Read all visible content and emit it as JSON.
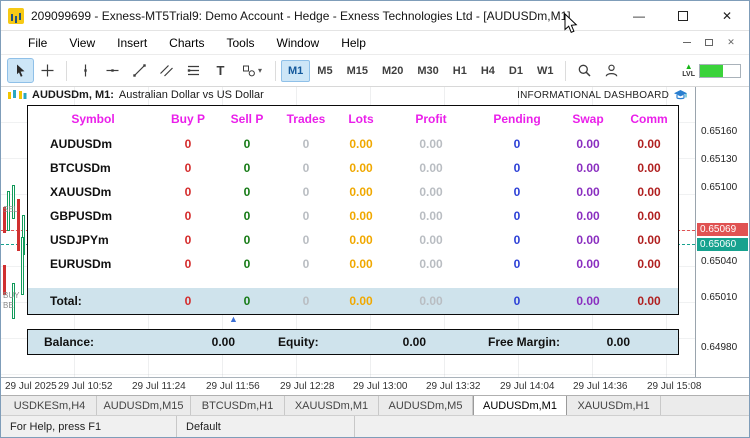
{
  "window": {
    "title": "209099699 - Exness-MT5Trial9: Demo Account - Hedge - Exness Technologies Ltd - [AUDUSDm,M1]"
  },
  "icons": {
    "minimize": "—",
    "close": "✕",
    "caret_down": "▾",
    "text_tool": "T",
    "up_triangle": "▲",
    "lvl_arrow": "▲"
  },
  "menu": {
    "items": [
      "File",
      "View",
      "Insert",
      "Charts",
      "Tools",
      "Window",
      "Help"
    ]
  },
  "toolbar": {
    "tools": [
      "cursor",
      "crosshair",
      "vertical-line",
      "horizontal-line",
      "trendline",
      "channel",
      "fibonacci",
      "text",
      "shapes",
      "search",
      "account",
      "lvl"
    ],
    "timeframes": [
      "M1",
      "M5",
      "M15",
      "M20",
      "M30",
      "H1",
      "H4",
      "D1",
      "W1"
    ],
    "active_timeframe": "M1",
    "lvl_label": "LVL"
  },
  "chart": {
    "header": {
      "symbol": "AUDUSDm, M1:",
      "description": "Australian Dollar vs US Dollar",
      "dashboard_title": "INFORMATIONAL DASHBOARD"
    },
    "left_labels": [
      "SEL",
      "BUY",
      "BE"
    ],
    "price_axis": [
      "0.65160",
      "0.65130",
      "0.65100",
      "0.65040",
      "0.65010",
      "0.64980"
    ],
    "ask_badge": "0.65069",
    "bid_badge": "0.65060",
    "time_axis": [
      "29 Jul 2025",
      "29 Jul 10:52",
      "29 Jul 11:24",
      "29 Jul 11:56",
      "29 Jul 12:28",
      "29 Jul 13:00",
      "29 Jul 13:32",
      "29 Jul 14:04",
      "29 Jul 14:36",
      "29 Jul 15:08"
    ]
  },
  "dashboard": {
    "columns": [
      "Symbol",
      "Buy P",
      "Sell P",
      "Trades",
      "Lots",
      "Profit",
      "Pending",
      "Swap",
      "Comm"
    ],
    "rows": [
      {
        "symbol": "AUDUSDm",
        "buy_p": "0",
        "sell_p": "0",
        "trades": "0",
        "lots": "0.00",
        "profit": "0.00",
        "pending": "0",
        "swap": "0.00",
        "comm": "0.00"
      },
      {
        "symbol": "BTCUSDm",
        "buy_p": "0",
        "sell_p": "0",
        "trades": "0",
        "lots": "0.00",
        "profit": "0.00",
        "pending": "0",
        "swap": "0.00",
        "comm": "0.00"
      },
      {
        "symbol": "XAUUSDm",
        "buy_p": "0",
        "sell_p": "0",
        "trades": "0",
        "lots": "0.00",
        "profit": "0.00",
        "pending": "0",
        "swap": "0.00",
        "comm": "0.00"
      },
      {
        "symbol": "GBPUSDm",
        "buy_p": "0",
        "sell_p": "0",
        "trades": "0",
        "lots": "0.00",
        "profit": "0.00",
        "pending": "0",
        "swap": "0.00",
        "comm": "0.00"
      },
      {
        "symbol": "USDJPYm",
        "buy_p": "0",
        "sell_p": "0",
        "trades": "0",
        "lots": "0.00",
        "profit": "0.00",
        "pending": "0",
        "swap": "0.00",
        "comm": "0.00"
      },
      {
        "symbol": "EURUSDm",
        "buy_p": "0",
        "sell_p": "0",
        "trades": "0",
        "lots": "0.00",
        "profit": "0.00",
        "pending": "0",
        "swap": "0.00",
        "comm": "0.00"
      }
    ],
    "total": {
      "label": "Total:",
      "buy_p": "0",
      "sell_p": "0",
      "trades": "0",
      "lots": "0.00",
      "profit": "0.00",
      "pending": "0",
      "swap": "0.00",
      "comm": "0.00"
    },
    "summary": {
      "balance_label": "Balance:",
      "balance": "0.00",
      "equity_label": "Equity:",
      "equity": "0.00",
      "free_margin_label": "Free Margin:",
      "free_margin": "0.00"
    }
  },
  "tabs": {
    "items": [
      "USDKESm,H4",
      "AUDUSDm,M15",
      "BTCUSDm,H1",
      "XAUUSDm,M1",
      "AUDUSDm,M5",
      "AUDUSDm,M1",
      "XAUUSDm,H1"
    ],
    "active": "AUDUSDm,M1"
  },
  "statusbar": {
    "help": "For Help, press F1",
    "profile": "Default"
  },
  "colors": {
    "header_magenta": "#ea1fea",
    "buy_red": "#d42a2a",
    "sell_green": "#157a15",
    "trades_gray": "#b9bdc2",
    "lots_orange": "#f0a800",
    "pending_blue": "#2b3fd6",
    "swap_purple": "#8a2fc0",
    "comm_darkred": "#b02020",
    "ask_badge": "#e05252",
    "bid_badge": "#17a28f",
    "summary_bg": "#cfe3ec",
    "timeframe_active_bg": "#cde6f7"
  }
}
